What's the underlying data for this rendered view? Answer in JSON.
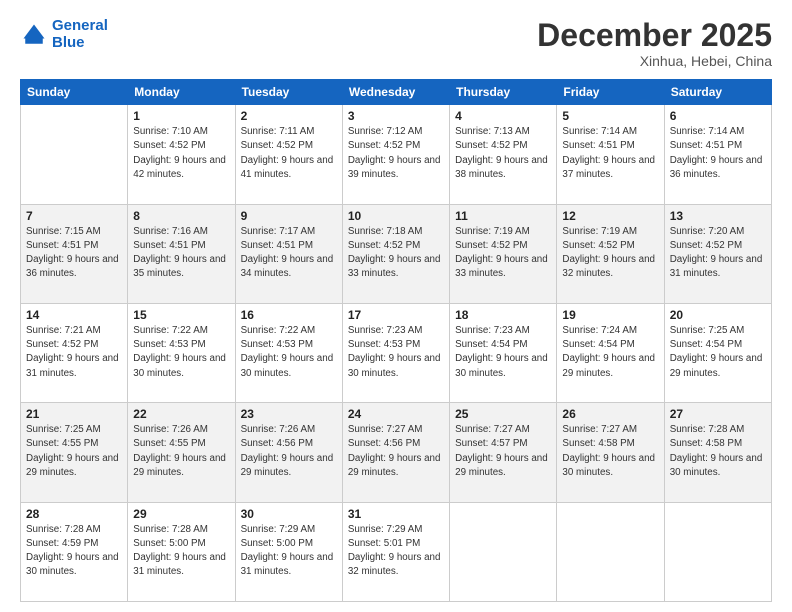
{
  "header": {
    "logo_line1": "General",
    "logo_line2": "Blue",
    "month": "December 2025",
    "location": "Xinhua, Hebei, China"
  },
  "weekdays": [
    "Sunday",
    "Monday",
    "Tuesday",
    "Wednesday",
    "Thursday",
    "Friday",
    "Saturday"
  ],
  "weeks": [
    [
      {
        "day": "",
        "sunrise": "",
        "sunset": "",
        "daylight": ""
      },
      {
        "day": "1",
        "sunrise": "Sunrise: 7:10 AM",
        "sunset": "Sunset: 4:52 PM",
        "daylight": "Daylight: 9 hours and 42 minutes."
      },
      {
        "day": "2",
        "sunrise": "Sunrise: 7:11 AM",
        "sunset": "Sunset: 4:52 PM",
        "daylight": "Daylight: 9 hours and 41 minutes."
      },
      {
        "day": "3",
        "sunrise": "Sunrise: 7:12 AM",
        "sunset": "Sunset: 4:52 PM",
        "daylight": "Daylight: 9 hours and 39 minutes."
      },
      {
        "day": "4",
        "sunrise": "Sunrise: 7:13 AM",
        "sunset": "Sunset: 4:52 PM",
        "daylight": "Daylight: 9 hours and 38 minutes."
      },
      {
        "day": "5",
        "sunrise": "Sunrise: 7:14 AM",
        "sunset": "Sunset: 4:51 PM",
        "daylight": "Daylight: 9 hours and 37 minutes."
      },
      {
        "day": "6",
        "sunrise": "Sunrise: 7:14 AM",
        "sunset": "Sunset: 4:51 PM",
        "daylight": "Daylight: 9 hours and 36 minutes."
      }
    ],
    [
      {
        "day": "7",
        "sunrise": "Sunrise: 7:15 AM",
        "sunset": "Sunset: 4:51 PM",
        "daylight": "Daylight: 9 hours and 36 minutes."
      },
      {
        "day": "8",
        "sunrise": "Sunrise: 7:16 AM",
        "sunset": "Sunset: 4:51 PM",
        "daylight": "Daylight: 9 hours and 35 minutes."
      },
      {
        "day": "9",
        "sunrise": "Sunrise: 7:17 AM",
        "sunset": "Sunset: 4:51 PM",
        "daylight": "Daylight: 9 hours and 34 minutes."
      },
      {
        "day": "10",
        "sunrise": "Sunrise: 7:18 AM",
        "sunset": "Sunset: 4:52 PM",
        "daylight": "Daylight: 9 hours and 33 minutes."
      },
      {
        "day": "11",
        "sunrise": "Sunrise: 7:19 AM",
        "sunset": "Sunset: 4:52 PM",
        "daylight": "Daylight: 9 hours and 33 minutes."
      },
      {
        "day": "12",
        "sunrise": "Sunrise: 7:19 AM",
        "sunset": "Sunset: 4:52 PM",
        "daylight": "Daylight: 9 hours and 32 minutes."
      },
      {
        "day": "13",
        "sunrise": "Sunrise: 7:20 AM",
        "sunset": "Sunset: 4:52 PM",
        "daylight": "Daylight: 9 hours and 31 minutes."
      }
    ],
    [
      {
        "day": "14",
        "sunrise": "Sunrise: 7:21 AM",
        "sunset": "Sunset: 4:52 PM",
        "daylight": "Daylight: 9 hours and 31 minutes."
      },
      {
        "day": "15",
        "sunrise": "Sunrise: 7:22 AM",
        "sunset": "Sunset: 4:53 PM",
        "daylight": "Daylight: 9 hours and 30 minutes."
      },
      {
        "day": "16",
        "sunrise": "Sunrise: 7:22 AM",
        "sunset": "Sunset: 4:53 PM",
        "daylight": "Daylight: 9 hours and 30 minutes."
      },
      {
        "day": "17",
        "sunrise": "Sunrise: 7:23 AM",
        "sunset": "Sunset: 4:53 PM",
        "daylight": "Daylight: 9 hours and 30 minutes."
      },
      {
        "day": "18",
        "sunrise": "Sunrise: 7:23 AM",
        "sunset": "Sunset: 4:54 PM",
        "daylight": "Daylight: 9 hours and 30 minutes."
      },
      {
        "day": "19",
        "sunrise": "Sunrise: 7:24 AM",
        "sunset": "Sunset: 4:54 PM",
        "daylight": "Daylight: 9 hours and 29 minutes."
      },
      {
        "day": "20",
        "sunrise": "Sunrise: 7:25 AM",
        "sunset": "Sunset: 4:54 PM",
        "daylight": "Daylight: 9 hours and 29 minutes."
      }
    ],
    [
      {
        "day": "21",
        "sunrise": "Sunrise: 7:25 AM",
        "sunset": "Sunset: 4:55 PM",
        "daylight": "Daylight: 9 hours and 29 minutes."
      },
      {
        "day": "22",
        "sunrise": "Sunrise: 7:26 AM",
        "sunset": "Sunset: 4:55 PM",
        "daylight": "Daylight: 9 hours and 29 minutes."
      },
      {
        "day": "23",
        "sunrise": "Sunrise: 7:26 AM",
        "sunset": "Sunset: 4:56 PM",
        "daylight": "Daylight: 9 hours and 29 minutes."
      },
      {
        "day": "24",
        "sunrise": "Sunrise: 7:27 AM",
        "sunset": "Sunset: 4:56 PM",
        "daylight": "Daylight: 9 hours and 29 minutes."
      },
      {
        "day": "25",
        "sunrise": "Sunrise: 7:27 AM",
        "sunset": "Sunset: 4:57 PM",
        "daylight": "Daylight: 9 hours and 29 minutes."
      },
      {
        "day": "26",
        "sunrise": "Sunrise: 7:27 AM",
        "sunset": "Sunset: 4:58 PM",
        "daylight": "Daylight: 9 hours and 30 minutes."
      },
      {
        "day": "27",
        "sunrise": "Sunrise: 7:28 AM",
        "sunset": "Sunset: 4:58 PM",
        "daylight": "Daylight: 9 hours and 30 minutes."
      }
    ],
    [
      {
        "day": "28",
        "sunrise": "Sunrise: 7:28 AM",
        "sunset": "Sunset: 4:59 PM",
        "daylight": "Daylight: 9 hours and 30 minutes."
      },
      {
        "day": "29",
        "sunrise": "Sunrise: 7:28 AM",
        "sunset": "Sunset: 5:00 PM",
        "daylight": "Daylight: 9 hours and 31 minutes."
      },
      {
        "day": "30",
        "sunrise": "Sunrise: 7:29 AM",
        "sunset": "Sunset: 5:00 PM",
        "daylight": "Daylight: 9 hours and 31 minutes."
      },
      {
        "day": "31",
        "sunrise": "Sunrise: 7:29 AM",
        "sunset": "Sunset: 5:01 PM",
        "daylight": "Daylight: 9 hours and 32 minutes."
      },
      {
        "day": "",
        "sunrise": "",
        "sunset": "",
        "daylight": ""
      },
      {
        "day": "",
        "sunrise": "",
        "sunset": "",
        "daylight": ""
      },
      {
        "day": "",
        "sunrise": "",
        "sunset": "",
        "daylight": ""
      }
    ]
  ]
}
